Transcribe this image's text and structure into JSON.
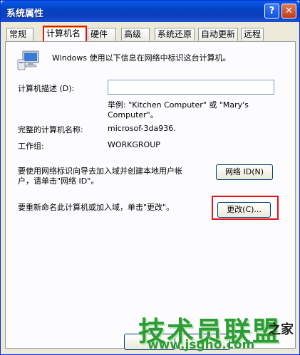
{
  "window": {
    "title": "系统属性",
    "help_label": "?",
    "close_label": "✕"
  },
  "tabs": [
    {
      "label": "常规"
    },
    {
      "label": "计算机名"
    },
    {
      "label": "硬件"
    },
    {
      "label": "高级"
    },
    {
      "label": "系统还原"
    },
    {
      "label": "自动更新"
    },
    {
      "label": "远程"
    }
  ],
  "panel": {
    "intro": "Windows 使用以下信息在网络中标识这台计算机。",
    "description_label": "计算机描述 (D):",
    "description_value": "",
    "example_line1": "举例: \"Kitchen Computer\" 或 \"Mary's",
    "example_line2": "Computer\"。",
    "full_name_label": "完整的计算机名称:",
    "full_name_value": "microsof-3da936.",
    "workgroup_label": "工作组:",
    "workgroup_value": "WORKGROUP",
    "network_hint_line1": "要使用网络标识向导去加入域并创建本地用户帐",
    "network_hint_line2": "户，请单击\"网络 ID\"。",
    "network_id_button": "网络 ID(N)",
    "rename_hint": "要重新命名此计算机或加入域，单击\"更改\"。",
    "change_button": "更改(C)..."
  },
  "watermark": {
    "brand": "技术员联盟",
    "home": "之家",
    "url": "www.jsgho.com"
  },
  "colors": {
    "highlight": "#e0141a",
    "title_bar": "#0243c5",
    "watermark_green": "#2d9c37"
  }
}
